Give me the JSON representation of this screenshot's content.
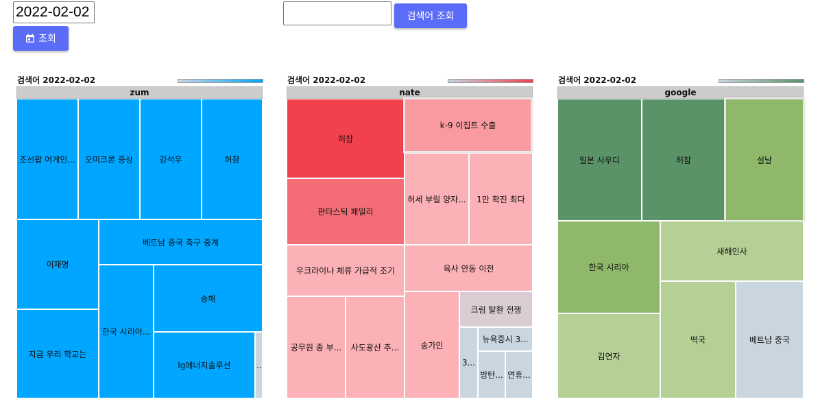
{
  "date_input": {
    "value": "2022-02-02"
  },
  "search_input": {
    "value": ""
  },
  "search_button": {
    "label": "검색어 조회"
  },
  "query_button": {
    "label": "조회",
    "icon": "calendar-icon"
  },
  "colors": {
    "button": "#5b6cf9",
    "zum": "#00a6ff",
    "nate_dark": "#f2404d",
    "nate_mid": "#f46d76",
    "nate_light": "#f99aa0",
    "nate_pale": "#fbb1b5",
    "google_dark": "#5b9368",
    "google_mid": "#8fb86b",
    "google_light": "#b4d095",
    "gray": "#c9d5df"
  },
  "charts": [
    {
      "title": "검색어 2022-02-02",
      "header": "zum",
      "tiles": [
        "조선팝 어게인...",
        "오미크론 증상",
        "강석우",
        "허참",
        "이재명",
        "베트남 중국 축구 중계",
        "지금 우리 학교는",
        "한국 시리아...",
        "송해",
        "lg에너지솔루션",
        ""
      ]
    },
    {
      "title": "검색어 2022-02-02",
      "header": "nate",
      "tiles": [
        "허참",
        "k-9 이집트 수출",
        "판타스틱 패밀리",
        "허세 부릴 양자...",
        "1만 확진 최다",
        "우크라이나 체류 가급적 조기",
        "육사 안동 이전",
        "공무원 종 부...",
        "사도광산 추...",
        "송가인",
        "크림 탈환 전쟁",
        "3...",
        "뉴욕증시 3...",
        "방탄...",
        "연휴..."
      ]
    },
    {
      "title": "검색어 2022-02-02",
      "header": "google",
      "tiles": [
        "일본 사우디",
        "허참",
        "설날",
        "한국 시리아",
        "새해인사",
        "김연자",
        "떡국",
        "베트남 중국"
      ]
    }
  ]
}
